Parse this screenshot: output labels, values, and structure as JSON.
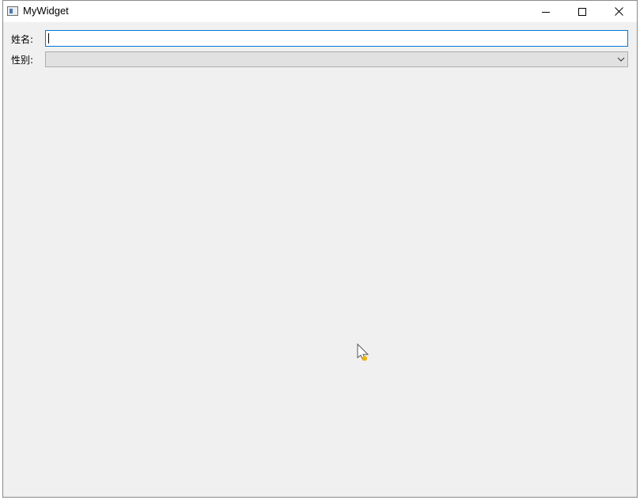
{
  "window": {
    "title": "MyWidget"
  },
  "icons": {
    "app": "window-app-icon",
    "minimize": "minimize-icon",
    "maximize": "maximize-icon",
    "close": "close-icon",
    "dropdown": "chevron-down-icon",
    "cursor": "mouse-pointer-icon"
  },
  "form": {
    "name_label": "姓名:",
    "name_value": "",
    "gender_label": "性别:",
    "gender_value": ""
  },
  "colors": {
    "focus_border": "#0078d7",
    "window_bg": "#f0f0f0",
    "combo_bg": "#e1e1e1"
  }
}
